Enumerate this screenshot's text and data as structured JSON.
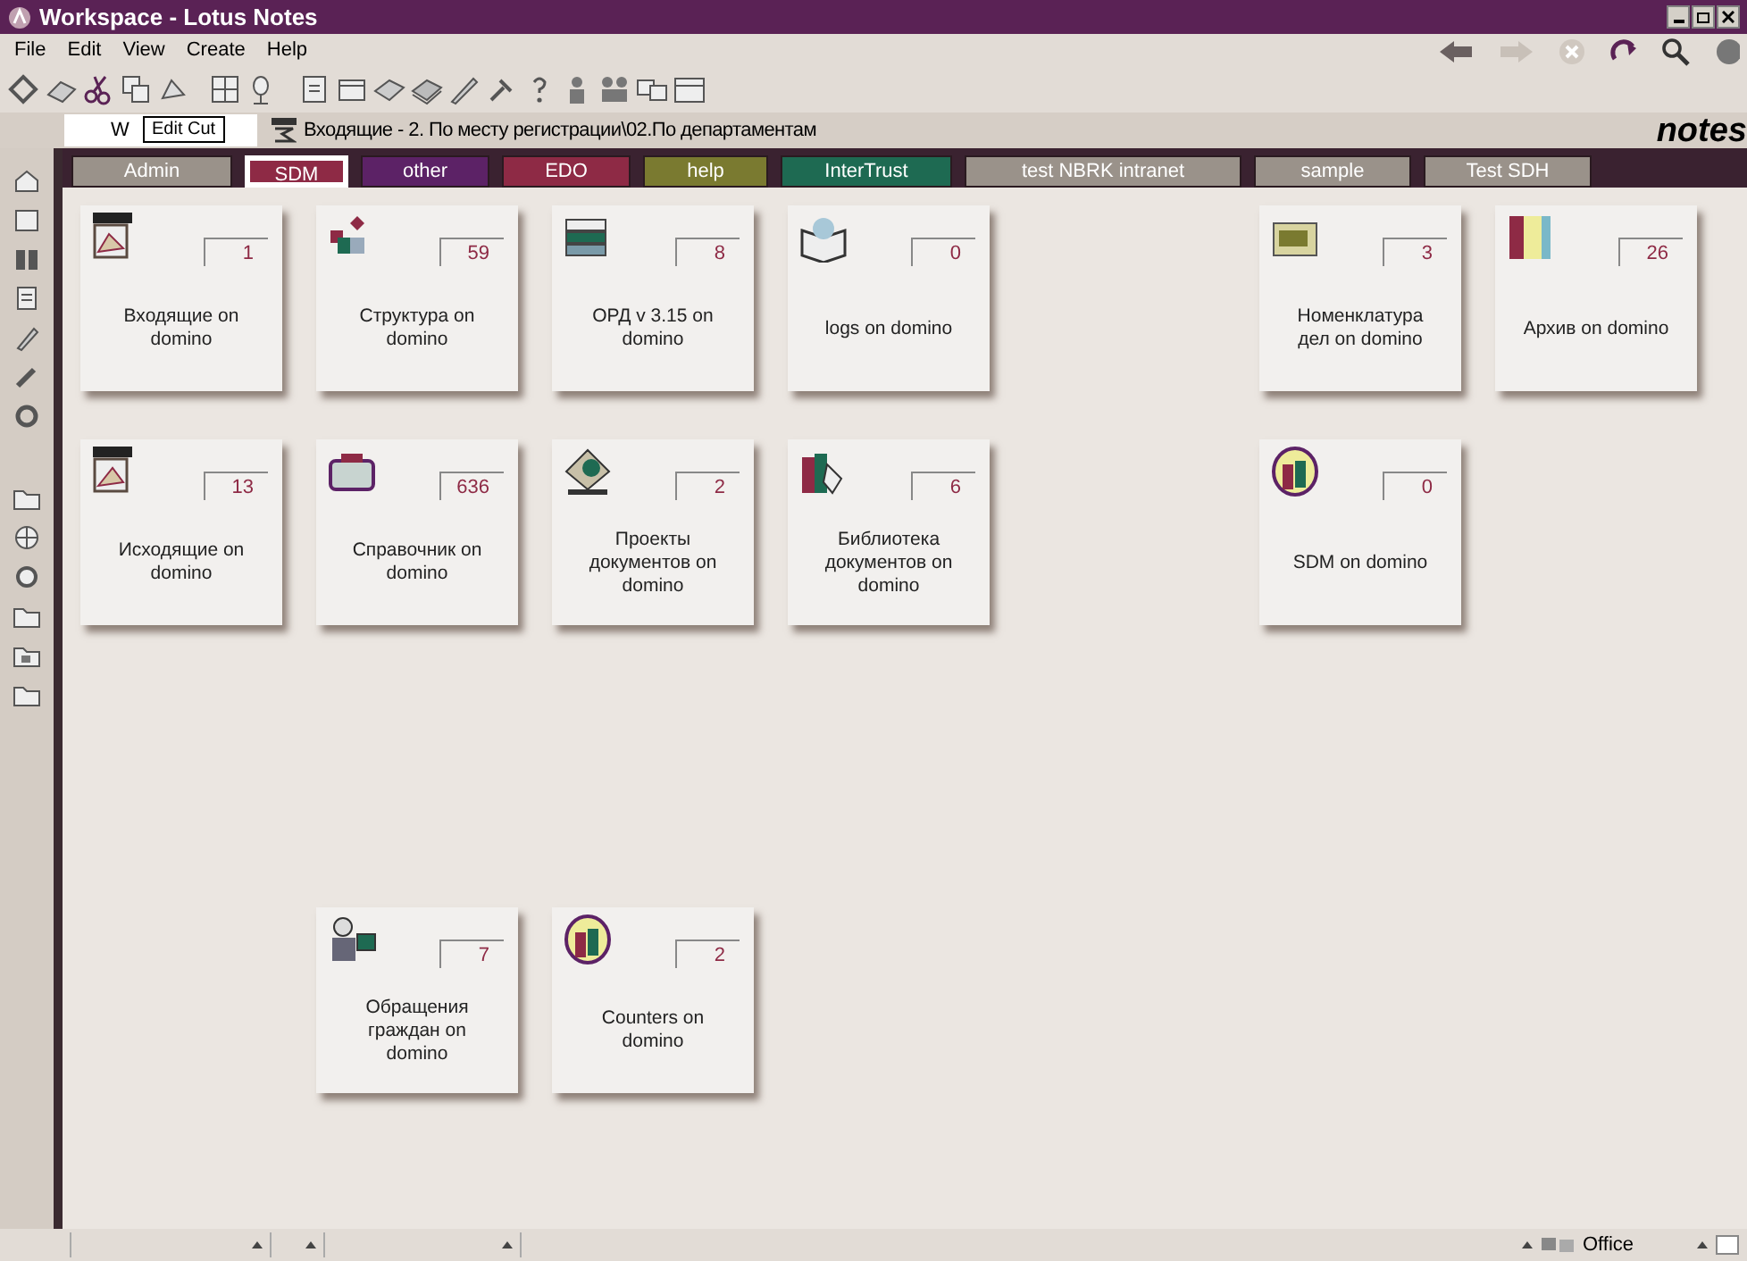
{
  "window": {
    "title": "Workspace - Lotus Notes"
  },
  "menu": [
    "File",
    "Edit",
    "View",
    "Create",
    "Help"
  ],
  "address_bar": {
    "field_value": "W",
    "tooltip": "Edit Cut",
    "breadcrumb": "Входящие - 2. По месту регистрации\\02.По департаментам",
    "logo": "notes"
  },
  "tabs": [
    {
      "label": "Admin",
      "selected": false,
      "color": "#9a928a"
    },
    {
      "label": "SDM",
      "selected": true,
      "color": "#8e2a45"
    },
    {
      "label": "other",
      "selected": false,
      "color": "#5c2266"
    },
    {
      "label": "EDO",
      "selected": false,
      "color": "#8e2a45"
    },
    {
      "label": "help",
      "selected": false,
      "color": "#7a7a30"
    },
    {
      "label": "InterTrust",
      "selected": false,
      "color": "#1e6a52"
    },
    {
      "label": "test NBRK intranet",
      "selected": false,
      "color": "#9a928a"
    },
    {
      "label": "sample",
      "selected": false,
      "color": "#9a928a"
    },
    {
      "label": "Test SDH",
      "selected": false,
      "color": "#9a928a"
    }
  ],
  "tiles": [
    {
      "count": "1",
      "label": "Входящие on domino"
    },
    {
      "count": "59",
      "label": "Структура on domino"
    },
    {
      "count": "8",
      "label": "ОРД v 3.15 on domino"
    },
    {
      "count": "0",
      "label": "logs on domino"
    },
    {
      "count": "3",
      "label": "Номенклатура дел on domino"
    },
    {
      "count": "26",
      "label": "Архив on domino"
    },
    {
      "count": "13",
      "label": "Исходящие on domino"
    },
    {
      "count": "636",
      "label": "Справочник on domino"
    },
    {
      "count": "2",
      "label": "Проекты документов on domino"
    },
    {
      "count": "6",
      "label": "Библиотека документов on domino"
    },
    {
      "count": "0",
      "label": "SDM on domino"
    },
    {
      "count": "7",
      "label": "Обращения граждан on domino"
    },
    {
      "count": "2",
      "label": "Counters on domino"
    }
  ],
  "status_bar": {
    "location": "Office"
  }
}
